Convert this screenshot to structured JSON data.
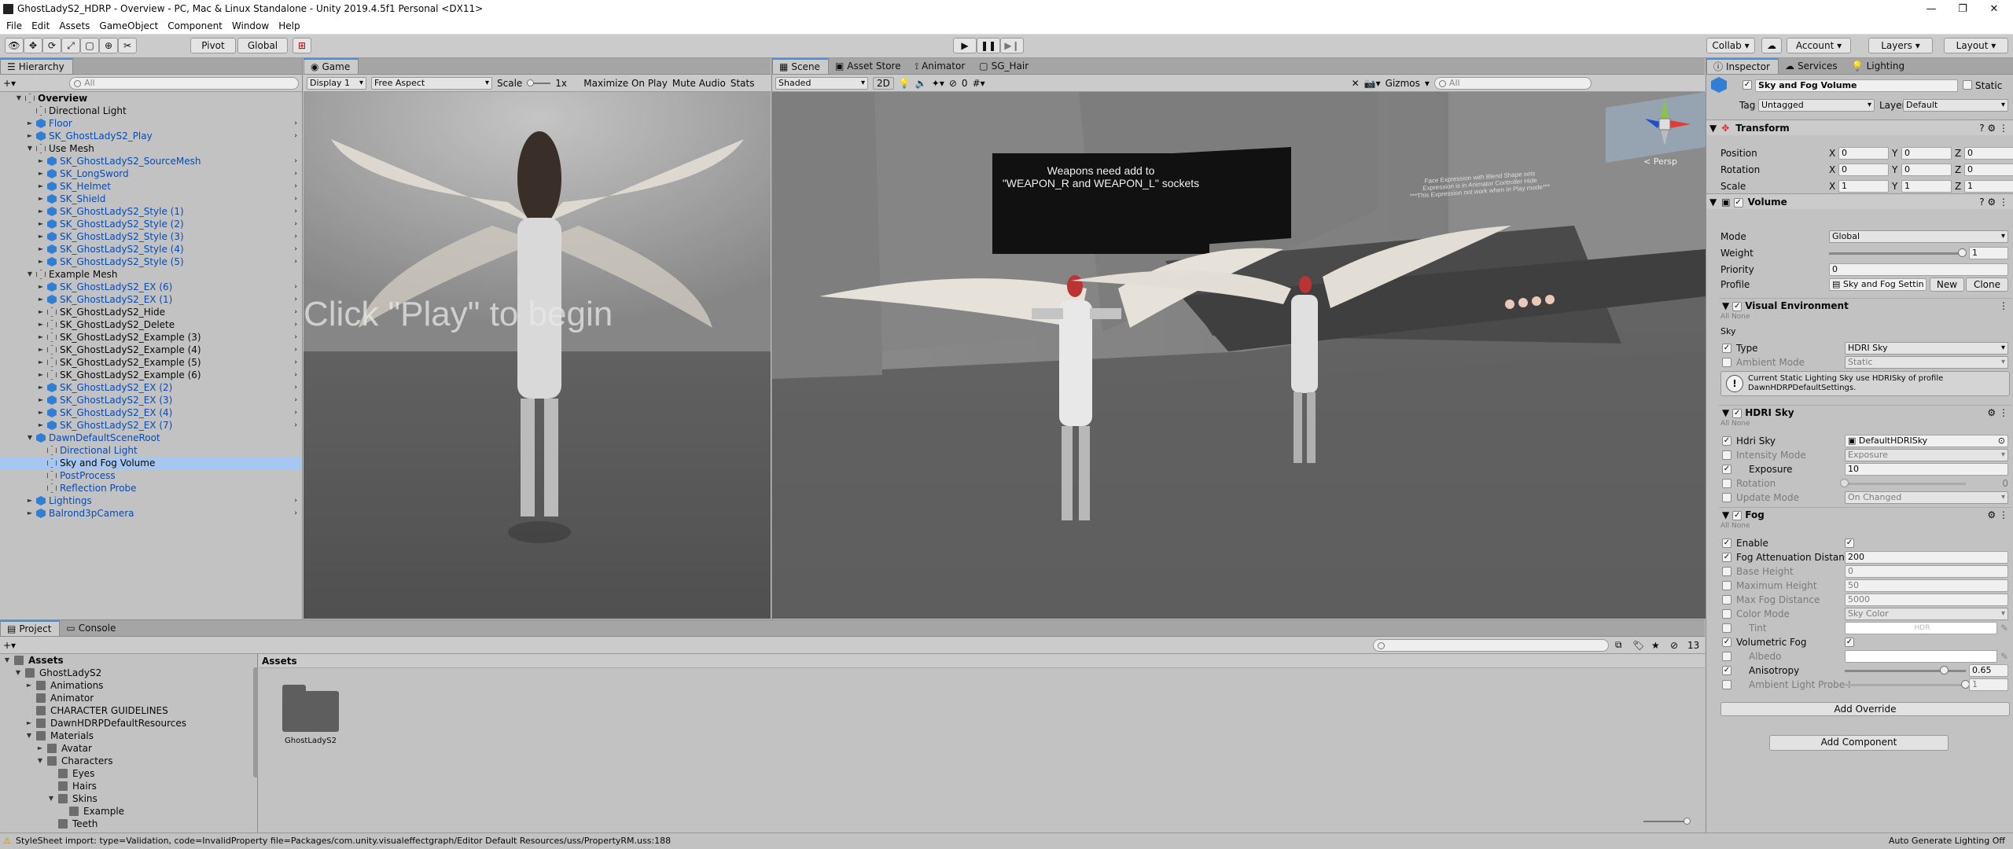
{
  "window": {
    "title": "GhostLadyS2_HDRP - Overview - PC, Mac & Linux Standalone - Unity 2019.4.5f1 Personal <DX11>"
  },
  "menu": [
    "File",
    "Edit",
    "Assets",
    "GameObject",
    "Component",
    "Window",
    "Help"
  ],
  "toolbar": {
    "pivot": "Pivot",
    "global": "Global",
    "collab": "Collab",
    "account": "Account",
    "layers": "Layers",
    "layout": "Layout"
  },
  "hierarchy": {
    "tab": "Hierarchy",
    "search_placeholder": "All",
    "items": [
      {
        "label": "Overview",
        "depth": 0,
        "arrow": "▼",
        "icon": "unity",
        "color": "black",
        "bold": true
      },
      {
        "label": "Directional Light",
        "depth": 1,
        "arrow": "",
        "icon": "gray",
        "color": "black"
      },
      {
        "label": "Floor",
        "depth": 1,
        "arrow": "►",
        "icon": "blue",
        "color": "blue"
      },
      {
        "label": "SK_GhostLadyS2_Play",
        "depth": 1,
        "arrow": "►",
        "icon": "blue",
        "color": "blue"
      },
      {
        "label": "Use Mesh",
        "depth": 1,
        "arrow": "▼",
        "icon": "gray",
        "color": "black"
      },
      {
        "label": "SK_GhostLadyS2_SourceMesh",
        "depth": 2,
        "arrow": "►",
        "icon": "blue",
        "color": "blue"
      },
      {
        "label": "SK_LongSword",
        "depth": 2,
        "arrow": "►",
        "icon": "blue",
        "color": "blue"
      },
      {
        "label": "SK_Helmet",
        "depth": 2,
        "arrow": "►",
        "icon": "blue",
        "color": "blue"
      },
      {
        "label": "SK_Shield",
        "depth": 2,
        "arrow": "►",
        "icon": "blue",
        "color": "blue"
      },
      {
        "label": "SK_GhostLadyS2_Style (1)",
        "depth": 2,
        "arrow": "►",
        "icon": "blue",
        "color": "blue"
      },
      {
        "label": "SK_GhostLadyS2_Style (2)",
        "depth": 2,
        "arrow": "►",
        "icon": "blue",
        "color": "blue"
      },
      {
        "label": "SK_GhostLadyS2_Style (3)",
        "depth": 2,
        "arrow": "►",
        "icon": "blue",
        "color": "blue"
      },
      {
        "label": "SK_GhostLadyS2_Style (4)",
        "depth": 2,
        "arrow": "►",
        "icon": "blue",
        "color": "blue"
      },
      {
        "label": "SK_GhostLadyS2_Style (5)",
        "depth": 2,
        "arrow": "►",
        "icon": "blue",
        "color": "blue"
      },
      {
        "label": "Example Mesh",
        "depth": 1,
        "arrow": "▼",
        "icon": "gray",
        "color": "black"
      },
      {
        "label": "SK_GhostLadyS2_EX (6)",
        "depth": 2,
        "arrow": "►",
        "icon": "blue",
        "color": "blue"
      },
      {
        "label": "SK_GhostLadyS2_EX (1)",
        "depth": 2,
        "arrow": "►",
        "icon": "blue",
        "color": "blue"
      },
      {
        "label": "SK_GhostLadyS2_Hide",
        "depth": 2,
        "arrow": "►",
        "icon": "gray",
        "color": "black"
      },
      {
        "label": "SK_GhostLadyS2_Delete",
        "depth": 2,
        "arrow": "►",
        "icon": "gray",
        "color": "black"
      },
      {
        "label": "SK_GhostLadyS2_Example (3)",
        "depth": 2,
        "arrow": "►",
        "icon": "gray",
        "color": "black"
      },
      {
        "label": "SK_GhostLadyS2_Example (4)",
        "depth": 2,
        "arrow": "►",
        "icon": "gray",
        "color": "black"
      },
      {
        "label": "SK_GhostLadyS2_Example (5)",
        "depth": 2,
        "arrow": "►",
        "icon": "gray",
        "color": "black"
      },
      {
        "label": "SK_GhostLadyS2_Example (6)",
        "depth": 2,
        "arrow": "►",
        "icon": "gray",
        "color": "black"
      },
      {
        "label": "SK_GhostLadyS2_EX (2)",
        "depth": 2,
        "arrow": "►",
        "icon": "blue",
        "color": "blue"
      },
      {
        "label": "SK_GhostLadyS2_EX (3)",
        "depth": 2,
        "arrow": "►",
        "icon": "blue",
        "color": "blue"
      },
      {
        "label": "SK_GhostLadyS2_EX (4)",
        "depth": 2,
        "arrow": "►",
        "icon": "blue",
        "color": "blue"
      },
      {
        "label": "SK_GhostLadyS2_EX (7)",
        "depth": 2,
        "arrow": "►",
        "icon": "blue",
        "color": "blue"
      },
      {
        "label": "DawnDefaultSceneRoot",
        "depth": 1,
        "arrow": "▼",
        "icon": "blue",
        "color": "blue"
      },
      {
        "label": "Directional Light",
        "depth": 2,
        "arrow": "",
        "icon": "gray",
        "color": "blue"
      },
      {
        "label": "Sky and Fog Volume",
        "depth": 2,
        "arrow": "",
        "icon": "gray",
        "color": "black",
        "selected": true
      },
      {
        "label": "PostProcess",
        "depth": 2,
        "arrow": "",
        "icon": "gray",
        "color": "blue"
      },
      {
        "label": "Reflection Probe",
        "depth": 2,
        "arrow": "",
        "icon": "gray",
        "color": "blue"
      },
      {
        "label": "Lightings",
        "depth": 1,
        "arrow": "►",
        "icon": "blue",
        "color": "blue"
      },
      {
        "label": "Balrond3pCamera",
        "depth": 1,
        "arrow": "►",
        "icon": "blue",
        "color": "blue"
      }
    ]
  },
  "game": {
    "tab": "Game",
    "display": "Display 1",
    "aspect": "Free Aspect",
    "scale_label": "Scale",
    "scale_value": "1x",
    "maximize": "Maximize On Play",
    "mute": "Mute Audio",
    "stats": "Stats",
    "overlay_text": "Click \"Play\" to begin"
  },
  "scene": {
    "tabs": [
      "Scene",
      "Asset Store",
      "Animator",
      "SG_Hair"
    ],
    "shading": "Shaded",
    "mode2d": "2D",
    "hidden_count": "0",
    "gizmos": "Gizmos",
    "search_placeholder": "All",
    "persp": "< Persp",
    "sign1_line1": "Weapons need add to",
    "sign1_line2": "\"WEAPON_R and WEAPON_L\" sockets",
    "sign2_line1": "Face Expression with Blend Shape sets",
    "sign2_line2": "Expression is in Animator Controller Hide",
    "sign2_line3": "***This Expression not work when In Play mode***"
  },
  "project": {
    "tabs": [
      "Project",
      "Console"
    ],
    "count": "13",
    "breadcrumb": "Assets",
    "tree": [
      {
        "label": "Assets",
        "depth": 0,
        "arrow": "▼",
        "bold": true
      },
      {
        "label": "GhostLadyS2",
        "depth": 1,
        "arrow": "▼"
      },
      {
        "label": "Animations",
        "depth": 2,
        "arrow": "►"
      },
      {
        "label": "Animator",
        "depth": 2,
        "arrow": ""
      },
      {
        "label": "CHARACTER GUIDELINES",
        "depth": 2,
        "arrow": ""
      },
      {
        "label": "DawnHDRPDefaultResources",
        "depth": 2,
        "arrow": "►"
      },
      {
        "label": "Materials",
        "depth": 2,
        "arrow": "▼"
      },
      {
        "label": "Avatar",
        "depth": 3,
        "arrow": "►"
      },
      {
        "label": "Characters",
        "depth": 3,
        "arrow": "▼"
      },
      {
        "label": "Eyes",
        "depth": 4,
        "arrow": ""
      },
      {
        "label": "Hairs",
        "depth": 4,
        "arrow": ""
      },
      {
        "label": "Skins",
        "depth": 4,
        "arrow": "▼"
      },
      {
        "label": "Example",
        "depth": 5,
        "arrow": ""
      },
      {
        "label": "Teeth",
        "depth": 4,
        "arrow": ""
      }
    ],
    "asset_items": [
      {
        "label": "GhostLadyS2"
      }
    ]
  },
  "inspector": {
    "tabs": [
      "Inspector",
      "Services",
      "Lighting"
    ],
    "object_name": "Sky and Fog Volume",
    "static_label": "Static",
    "tag_label": "Tag",
    "tag_value": "Untagged",
    "layer_label": "Layer",
    "layer_value": "Default",
    "transform": {
      "title": "Transform",
      "position_label": "Position",
      "rotation_label": "Rotation",
      "scale_label": "Scale",
      "x": "X",
      "y": "Y",
      "z": "Z",
      "position": [
        "0",
        "0",
        "0"
      ],
      "rotation": [
        "0",
        "0",
        "0"
      ],
      "scale": [
        "1",
        "1",
        "1"
      ]
    },
    "volume": {
      "title": "Volume",
      "mode_label": "Mode",
      "mode": "Global",
      "weight_label": "Weight",
      "weight": "1",
      "weight_level": 1.0,
      "priority_label": "Priority",
      "priority": "0",
      "profile_label": "Profile",
      "profile": "Sky and Fog Settin",
      "new": "New",
      "clone": "Clone"
    },
    "visual_env": {
      "title": "Visual Environment",
      "all": "All",
      "none": "None",
      "sky": "Sky",
      "type_label": "Type",
      "type": "HDRI Sky",
      "ambient_label": "Ambient Mode",
      "ambient": "Static",
      "info_line1": "Current Static Lighting Sky use HDRISky of profile",
      "info_line2": "DawnHDRPDefaultSettings."
    },
    "hdri": {
      "title": "HDRI Sky",
      "all": "All",
      "none": "None",
      "hdri_label": "Hdri Sky",
      "hdri": "DefaultHDRISky",
      "intensity_label": "Intensity Mode",
      "intensity": "Exposure",
      "exposure_label": "Exposure",
      "exposure": "10",
      "rotation_label": "Rotation",
      "rotation": "0",
      "rotation_level": 0.0,
      "update_label": "Update Mode",
      "update": "On Changed"
    },
    "fog": {
      "title": "Fog",
      "all": "All",
      "none": "None",
      "enable_label": "Enable",
      "atten_label": "Fog Attenuation Distanc",
      "atten": "200",
      "base_label": "Base Height",
      "base": "0",
      "max_label": "Maximum Height",
      "max": "50",
      "maxdist_label": "Max Fog Distance",
      "maxdist": "5000",
      "color_label": "Color Mode",
      "color": "Sky Color",
      "tint_label": "Tint",
      "tint": "HDR",
      "vol_label": "Volumetric Fog",
      "albedo_label": "Albedo",
      "aniso_label": "Anisotropy",
      "aniso": "0.65",
      "aniso_level": 0.825,
      "probe_label": "Ambient Light Probe I",
      "probe": "1",
      "probe_level": 1.0
    },
    "add_override": "Add Override",
    "add_component": "Add Component"
  },
  "status": {
    "message": "StyleSheet import: type=Validation, code=InvalidProperty file=Packages/com.unity.visualeffectgraph/Editor Default Resources/uss/PropertyRM.uss:188",
    "right": "Auto Generate Lighting Off"
  },
  "colors": {
    "accent": "#4a90d9",
    "selection": "#a6c8f0",
    "link": "#0b4bb0"
  }
}
